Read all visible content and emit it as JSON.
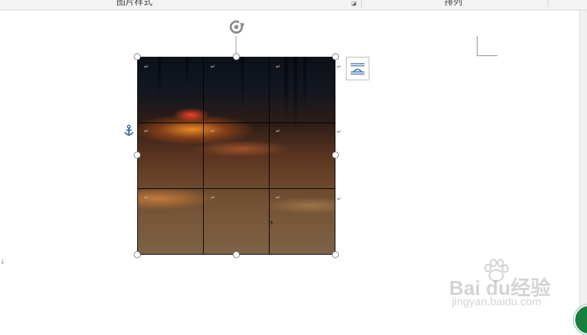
{
  "ribbon": {
    "group_picture_styles": "图片样式",
    "group_arrange": "排列",
    "launcher_icon": "dialog-launcher-icon"
  },
  "document": {
    "paragraph_mark": "↵",
    "left_mark": "↓"
  },
  "image": {
    "description_icons": [
      "rotate-handle-icon",
      "anchor-icon",
      "layout-options-icon"
    ],
    "grid": {
      "rows": 3,
      "cols": 3
    }
  },
  "watermark": {
    "logo_text": "Bai  du经验",
    "sub_text": "jingyan.baidu.com"
  }
}
